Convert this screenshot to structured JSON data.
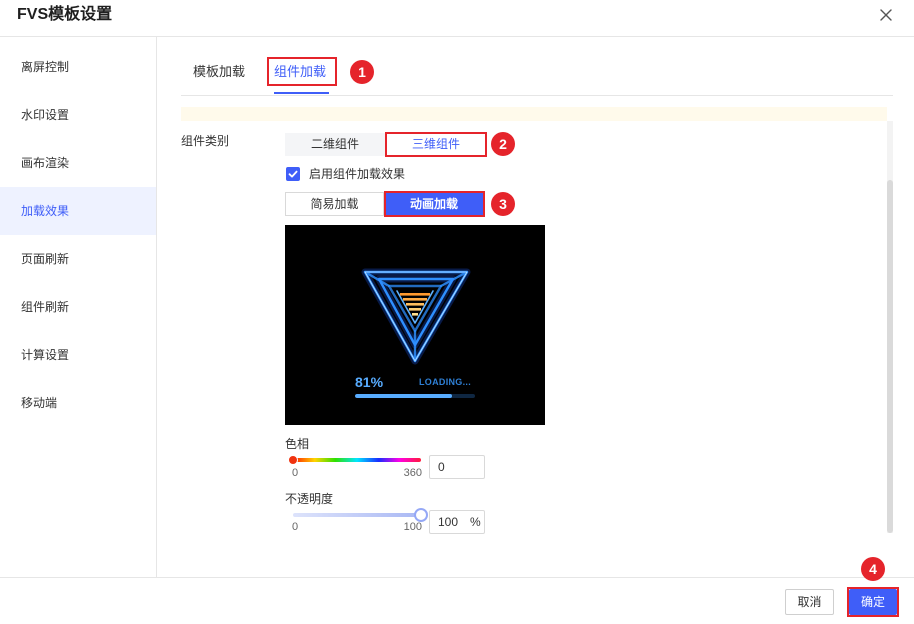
{
  "dialog": {
    "title": "FVS模板设置",
    "close_icon": "close-icon"
  },
  "sidebar": {
    "items": [
      {
        "label": "离屏控制",
        "active": false
      },
      {
        "label": "水印设置",
        "active": false
      },
      {
        "label": "画布渲染",
        "active": false
      },
      {
        "label": "加载效果",
        "active": true
      },
      {
        "label": "页面刷新",
        "active": false
      },
      {
        "label": "组件刷新",
        "active": false
      },
      {
        "label": "计算设置",
        "active": false
      },
      {
        "label": "移动端",
        "active": false
      }
    ]
  },
  "tabs": [
    {
      "label": "模板加载",
      "active": false
    },
    {
      "label": "组件加载",
      "active": true
    }
  ],
  "component_type": {
    "label": "组件类别",
    "options": [
      {
        "label": "二维组件",
        "selected": false
      },
      {
        "label": "三维组件",
        "selected": true
      }
    ]
  },
  "enable_effect": {
    "label": "启用组件加载效果",
    "checked": true
  },
  "load_mode": {
    "options": [
      {
        "label": "简易加载",
        "selected": false
      },
      {
        "label": "动画加载",
        "selected": true
      }
    ]
  },
  "preview": {
    "percent_text": "81%",
    "loading_text": "LOADING...",
    "progress": 0.81
  },
  "hue": {
    "label": "色相",
    "min_label": "0",
    "max_label": "360",
    "value": "0"
  },
  "opacity": {
    "label": "不透明度",
    "min_label": "0",
    "max_label": "100",
    "value": "100",
    "unit": "%"
  },
  "footer": {
    "cancel_label": "取消",
    "confirm_label": "确定"
  },
  "annotations": {
    "step1": "1",
    "step2": "2",
    "step3": "3",
    "step4": "4"
  },
  "colors": {
    "accent": "#3f5ef8",
    "annotation": "#e5242b",
    "sidebar_active_bg": "#eef2ff",
    "notice_bg": "#fffaeb",
    "neon": "#2e8fff"
  }
}
